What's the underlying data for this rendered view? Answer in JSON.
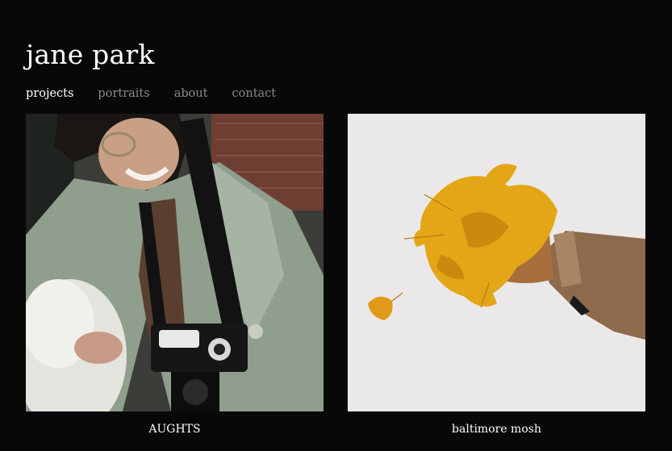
{
  "site": {
    "title": "jane park"
  },
  "nav": {
    "items": [
      {
        "label": "projects",
        "active": true
      },
      {
        "label": "portraits",
        "active": false
      },
      {
        "label": "about",
        "active": false
      },
      {
        "label": "contact",
        "active": false
      }
    ]
  },
  "projects": [
    {
      "caption": "AUGHTS",
      "image": "photo-smiling-person-green-coat-camera"
    },
    {
      "caption": "baltimore mosh",
      "image": "photo-hand-throwing-yellow-ginkgo-leaves"
    }
  ],
  "colors": {
    "background": "#080808",
    "text": "#ffffff",
    "nav_inactive": "#8a8a8a"
  }
}
